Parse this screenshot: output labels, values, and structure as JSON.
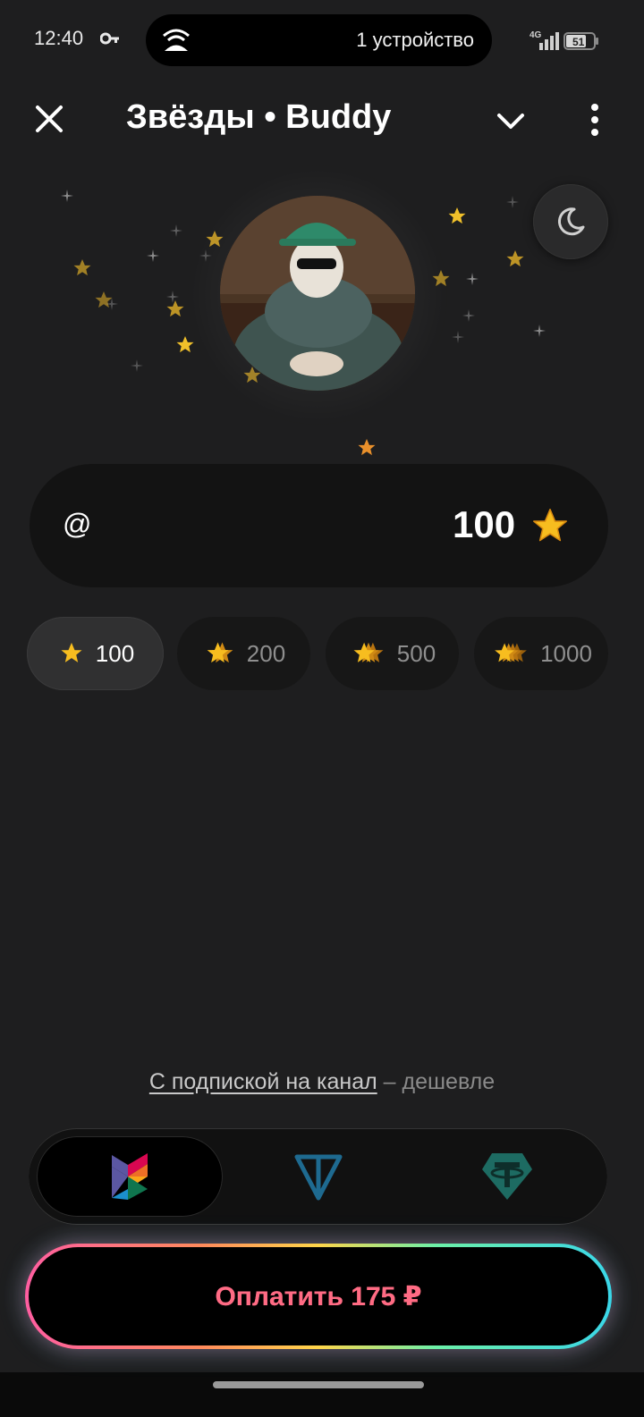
{
  "status_bar": {
    "time": "12:40",
    "island_text": "1 устройство",
    "network": "4G",
    "battery": "51"
  },
  "header": {
    "title": "Звёзды • Buddy"
  },
  "field": {
    "prefix": "@",
    "amount": "100"
  },
  "chips": [
    {
      "label": "100",
      "selected": true
    },
    {
      "label": "200",
      "selected": false
    },
    {
      "label": "500",
      "selected": false
    },
    {
      "label": "1000",
      "selected": false
    }
  ],
  "promo": {
    "link": "С подпиской на канал",
    "suffix": "– дешевле"
  },
  "payment_methods": [
    "sbp-icon",
    "ton-icon",
    "tether-icon"
  ],
  "pay_button": {
    "label": "Оплатить 175 ₽"
  },
  "colors": {
    "background": "#1e1e1f",
    "star": "#f5b81c",
    "pay_text": "#ff6b84",
    "ton": "#1e6a90",
    "tether": "#1d6b62"
  }
}
